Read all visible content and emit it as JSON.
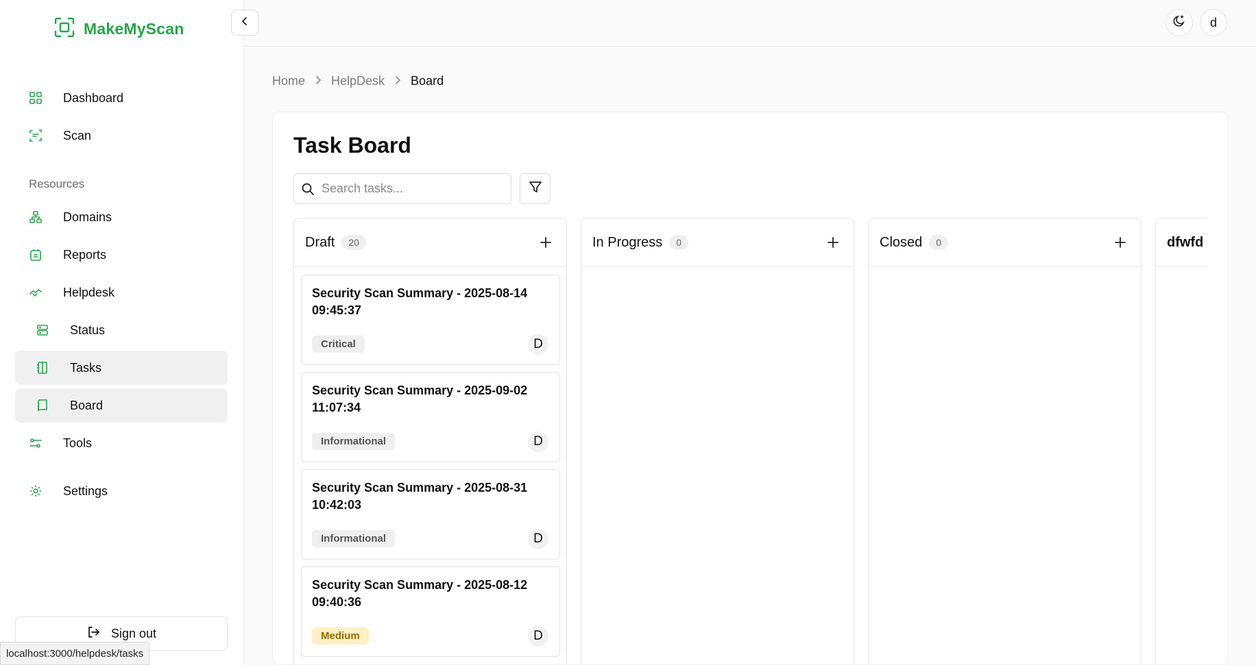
{
  "brand": {
    "name": "MakeMyScan",
    "accent": "#22a84a"
  },
  "sidebar": {
    "items": [
      {
        "label": "Dashboard",
        "icon": "grid-icon"
      },
      {
        "label": "Scan",
        "icon": "scan-icon"
      }
    ],
    "resources_label": "Resources",
    "resource_items": [
      {
        "label": "Domains",
        "icon": "network-icon"
      },
      {
        "label": "Reports",
        "icon": "clipboard-icon"
      },
      {
        "label": "Helpdesk",
        "icon": "handshake-icon"
      },
      {
        "label": "Status",
        "icon": "server-icon"
      },
      {
        "label": "Tasks",
        "icon": "notebook-icon"
      },
      {
        "label": "Board",
        "icon": "book-icon"
      },
      {
        "label": "Tools",
        "icon": "sliders-icon"
      },
      {
        "label": "Settings",
        "icon": "gear-icon"
      }
    ],
    "signout_label": "Sign out"
  },
  "status_url": "localhost:3000/helpdesk/tasks",
  "header": {
    "avatar_initial": "d"
  },
  "breadcrumb": [
    "Home",
    "HelpDesk",
    "Board"
  ],
  "page": {
    "title": "Task Board",
    "search_placeholder": "Search tasks..."
  },
  "columns": [
    {
      "title": "Draft",
      "count": "20"
    },
    {
      "title": "In Progress",
      "count": "0"
    },
    {
      "title": "Closed",
      "count": "0"
    },
    {
      "title": "dfwfd"
    }
  ],
  "tasks": [
    {
      "title": "Security Scan Summary - 2025-08-14 09:45:37",
      "severity": "Critical",
      "assignee": "D"
    },
    {
      "title": "Security Scan Summary - 2025-09-02 11:07:34",
      "severity": "Informational",
      "assignee": "D"
    },
    {
      "title": "Security Scan Summary - 2025-08-31 10:42:03",
      "severity": "Informational",
      "assignee": "D"
    },
    {
      "title": "Security Scan Summary - 2025-08-12 09:40:36",
      "severity": "Medium",
      "assignee": "D"
    }
  ]
}
